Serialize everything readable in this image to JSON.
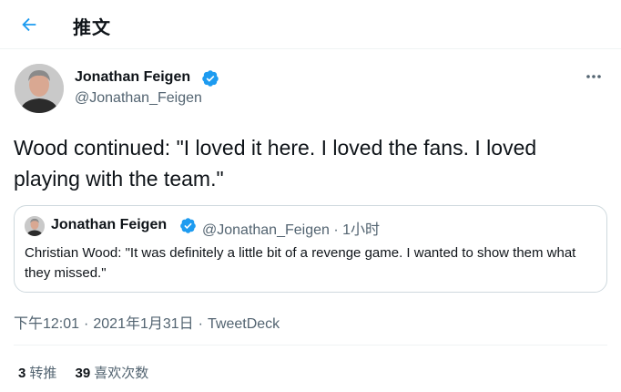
{
  "header": {
    "title": "推文",
    "back_icon": "arrow-left-icon"
  },
  "author": {
    "name": "Jonathan Feigen",
    "handle": "@Jonathan_Feigen",
    "verified": true
  },
  "tweet": {
    "text": "Wood continued: \"I loved it here. I loved the fans. I loved playing with the team.\""
  },
  "quote": {
    "name": "Jonathan Feigen",
    "handle_time": "@Jonathan_Feigen · 1小时",
    "text": "Christian Wood: \"It was definitely a little bit of a revenge game. I wanted to show them what they missed.\""
  },
  "meta": {
    "time": "下午12:01",
    "separator": "·",
    "date": "2021年1月31日",
    "source": "TweetDeck"
  },
  "stats": {
    "retweets_count": "3",
    "retweets_label": "转推",
    "likes_count": "39",
    "likes_label": "喜欢次数"
  },
  "colors": {
    "accent": "#1d9bf0",
    "text_primary": "#0f1419",
    "text_secondary": "#536471",
    "border": "#cfd9de"
  }
}
